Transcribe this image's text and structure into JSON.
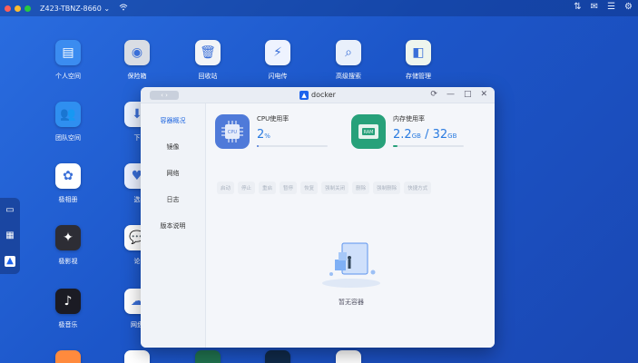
{
  "topbar": {
    "device_name": "Z423-TBNZ-8660",
    "device_caret": "⌄",
    "traffic_colors": [
      "#ff5f57",
      "#febc2e",
      "#28c840"
    ]
  },
  "desktop": {
    "apps": [
      {
        "label": "个人空间",
        "icon": "folder-icon",
        "glyph": "▤",
        "color": "#3b8cf0"
      },
      {
        "label": "保险箱",
        "icon": "safe-icon",
        "glyph": "◉",
        "color": "#d9dde4"
      },
      {
        "label": "回收站",
        "icon": "trash-icon",
        "glyph": "🗑",
        "color": "#f2f4f7"
      },
      {
        "label": "闪电传",
        "icon": "flash-transfer-icon",
        "glyph": "⚡",
        "color": "#eef3ff"
      },
      {
        "label": "高级搜索",
        "icon": "search-icon",
        "glyph": "⌕",
        "color": "#e9f0fb"
      },
      {
        "label": "存储管理",
        "icon": "storage-icon",
        "glyph": "◧",
        "color": "#eef5ee"
      },
      {
        "label": "团队空间",
        "icon": "team-folder-icon",
        "glyph": "👥",
        "color": "#2f8ff0"
      },
      {
        "label": "下",
        "icon": "download-icon",
        "glyph": "⬇",
        "color": "#eaf2ff"
      },
      {
        "label": "极相册",
        "icon": "photos-icon",
        "glyph": "✿",
        "color": "#ffffff"
      },
      {
        "label": "选",
        "icon": "selection-icon",
        "glyph": "♥",
        "color": "#eaf0ff"
      },
      {
        "label": "极影视",
        "icon": "video-icon",
        "glyph": "✦",
        "color": "#2d2d35"
      },
      {
        "label": "论",
        "icon": "forum-icon",
        "glyph": "💬",
        "color": "#ffffff"
      },
      {
        "label": "极音乐",
        "icon": "music-icon",
        "glyph": "♪",
        "color": "#1b1b24"
      },
      {
        "label": "网盘",
        "icon": "cloud-drive-icon",
        "glyph": "☁",
        "color": "#ffffff"
      }
    ]
  },
  "window": {
    "title": "docker",
    "nav_back": "‹",
    "nav_forward": "›",
    "btn_refresh": "⟳",
    "btn_minimize": "—",
    "btn_maximize": "□",
    "btn_close": "✕",
    "sidebar": [
      "容器概况",
      "镜像",
      "网络",
      "日志",
      "版本说明"
    ],
    "cpu": {
      "label": "CPU使用率",
      "value": "2",
      "unit": "%",
      "percent": 2,
      "chip_text": "CPU",
      "color": "#4f7ad9"
    },
    "memory": {
      "label": "内存使用率",
      "used": "2.2",
      "used_unit": "GB",
      "separator": "/",
      "total": "32",
      "total_unit": "GB",
      "percent": 6.9,
      "chip_text": "RAM",
      "color": "#27a17a"
    },
    "toolbar": [
      "启动",
      "停止",
      "重启",
      "暂停",
      "恢复",
      "强制关闭",
      "删除",
      "强制删除",
      "快捷方式"
    ],
    "empty_text": "暂无容器"
  }
}
